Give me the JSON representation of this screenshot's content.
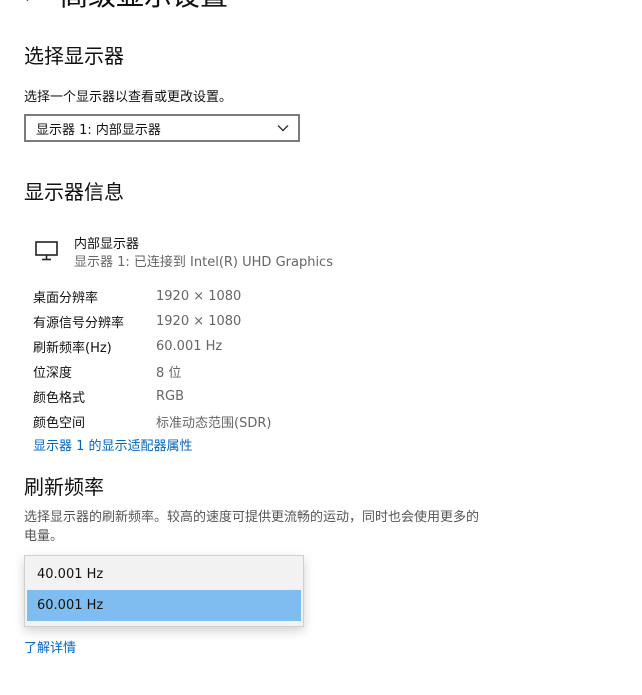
{
  "header": {
    "title": "高级显示设置"
  },
  "select_display": {
    "heading": "选择显示器",
    "description": "选择一个显示器以查看或更改设置。",
    "selected_value": "显示器 1: 内部显示器"
  },
  "display_info": {
    "heading": "显示器信息",
    "monitor_name": "内部显示器",
    "monitor_subtitle": "显示器 1: 已连接到 Intel(R) UHD Graphics",
    "rows": [
      {
        "label": "桌面分辨率",
        "value": "1920 × 1080"
      },
      {
        "label": "有源信号分辨率",
        "value": "1920 × 1080"
      },
      {
        "label": "刷新频率(Hz)",
        "value": "60.001 Hz"
      },
      {
        "label": "位深度",
        "value": "8 位"
      },
      {
        "label": "颜色格式",
        "value": "RGB"
      },
      {
        "label": "颜色空间",
        "value": "标准动态范围(SDR)"
      }
    ],
    "adapter_link": "显示器 1 的显示适配器属性"
  },
  "refresh_rate": {
    "heading": "刷新频率",
    "description": "选择显示器的刷新频率。较高的速度可提供更流畅的运动，同时也会使用更多的电量。",
    "options": [
      "40.001 Hz",
      "60.001 Hz"
    ],
    "selected_option": "60.001 Hz",
    "learn_more_link": "了解详情"
  },
  "colors": {
    "link": "#0067c0",
    "selected_option_bg": "#7fbdf0"
  },
  "icons": {
    "back": "back-arrow-icon",
    "dropdown": "chevron-down-icon",
    "monitor": "monitor-icon"
  }
}
